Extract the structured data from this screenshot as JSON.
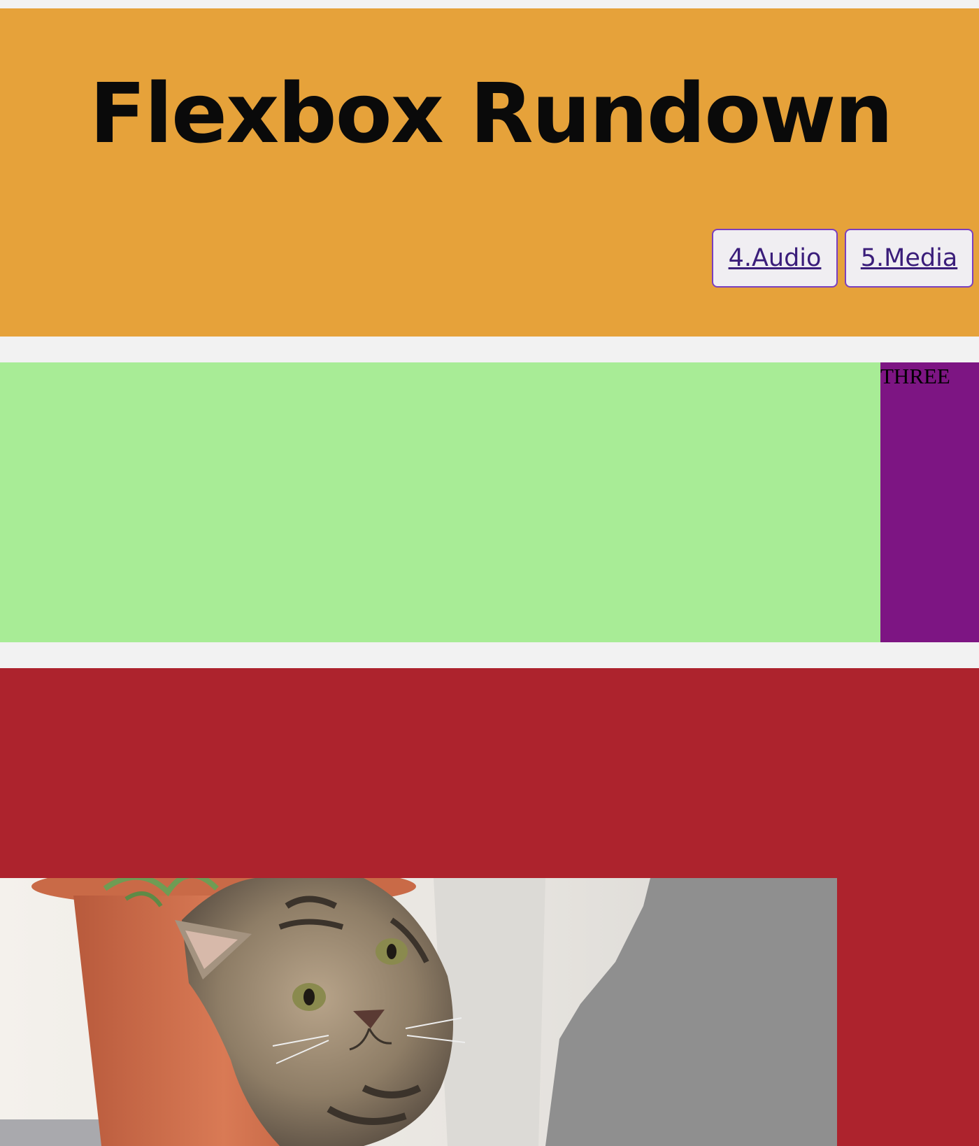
{
  "header": {
    "title": "Flexbox Rundown",
    "background": "#e6a23a",
    "nav": [
      {
        "label": "4.Audio"
      },
      {
        "label": "5.Media"
      }
    ]
  },
  "sections": {
    "panel_one_color": "#a8ec96",
    "panel_three": {
      "label": "THREE",
      "color": "#7d1583"
    },
    "footer_color": "#ad232d"
  },
  "image": {
    "subject": "kitten-beside-flowerpot"
  }
}
